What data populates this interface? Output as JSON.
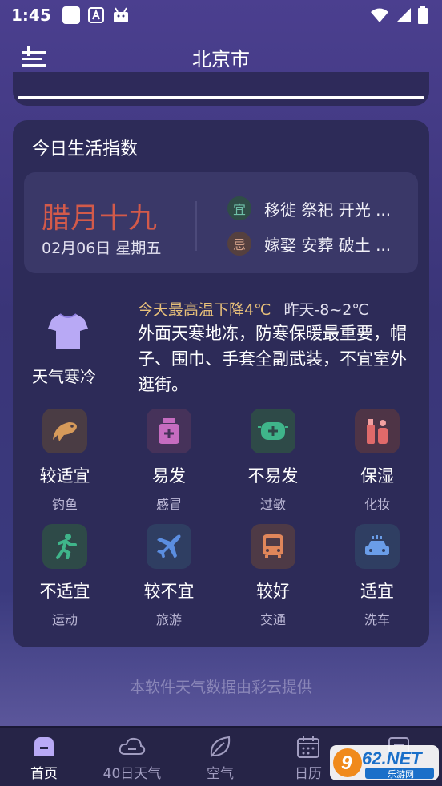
{
  "status": {
    "time": "1:45"
  },
  "header": {
    "city": "北京市"
  },
  "card": {
    "title": "今日生活指数",
    "almanac": {
      "lunar_date": "腊月十九",
      "date": "02月06日 星期五",
      "yi_label": "宜",
      "yi_text": "移徙 祭祀 开光 ...",
      "ji_label": "忌",
      "ji_text": "嫁娶 安葬 破土 ..."
    },
    "weather": {
      "label": "天气寒冷",
      "headline": "今天最高温下降4℃",
      "yesterday": "昨天-8~2℃",
      "advice": "外面天寒地冻，防寒保暖最重要，帽子、围巾、手套全副武装，不宜室外逛街。"
    },
    "indices": [
      {
        "value": "较适宜",
        "name": "钓鱼",
        "icon": "fish-icon",
        "color": "#d69a5a"
      },
      {
        "value": "易发",
        "name": "感冒",
        "icon": "medicine-icon",
        "color": "#c66cc0"
      },
      {
        "value": "不易发",
        "name": "过敏",
        "icon": "mask-icon",
        "color": "#3fb58a"
      },
      {
        "value": "保湿",
        "name": "化妆",
        "icon": "cosmetics-icon",
        "color": "#e06a6a"
      },
      {
        "value": "不适宜",
        "name": "运动",
        "icon": "running-icon",
        "color": "#3fb58a"
      },
      {
        "value": "较不宜",
        "name": "旅游",
        "icon": "airplane-icon",
        "color": "#5b8de0"
      },
      {
        "value": "较好",
        "name": "交通",
        "icon": "bus-icon",
        "color": "#e0865a"
      },
      {
        "value": "适宜",
        "name": "洗车",
        "icon": "car-icon",
        "color": "#6a9de8"
      }
    ]
  },
  "footer_note": "本软件天气数据由彩云提供",
  "tabs": [
    {
      "label": "首页",
      "icon": "home-icon",
      "active": true
    },
    {
      "label": "40日天气",
      "icon": "cloud-icon",
      "active": false
    },
    {
      "label": "空气",
      "icon": "leaf-icon",
      "active": false
    },
    {
      "label": "日历",
      "icon": "calendar-icon",
      "active": false
    }
  ],
  "watermark": {
    "brand": "962.NET",
    "sub": "乐游网"
  }
}
